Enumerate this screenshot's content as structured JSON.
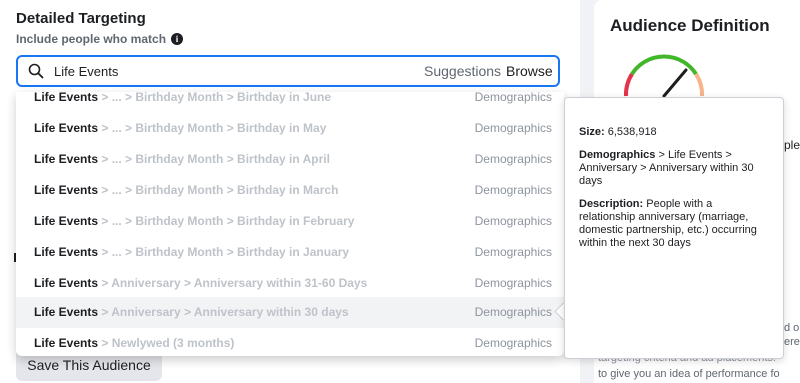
{
  "targeting": {
    "title": "Detailed Targeting",
    "subtitle": "Include people who match",
    "search_value": "Life Events",
    "suggestions_label": "Suggestions",
    "browse_label": "Browse"
  },
  "dropdown": {
    "rows": [
      {
        "root": "Life Events",
        "path": " > ... > Birthday Month > Birthday in June",
        "category": "Demographics"
      },
      {
        "root": "Life Events",
        "path": " > ... > Birthday Month > Birthday in May",
        "category": "Demographics"
      },
      {
        "root": "Life Events",
        "path": " > ... > Birthday Month > Birthday in April",
        "category": "Demographics"
      },
      {
        "root": "Life Events",
        "path": " > ... > Birthday Month > Birthday in March",
        "category": "Demographics"
      },
      {
        "root": "Life Events",
        "path": " > ... > Birthday Month > Birthday in February",
        "category": "Demographics"
      },
      {
        "root": "Life Events",
        "path": " > ... > Birthday Month > Birthday in January",
        "category": "Demographics"
      },
      {
        "root": "Life Events",
        "path": " > Anniversary > Anniversary within 31-60 Days",
        "category": "Demographics"
      },
      {
        "root": "Life Events",
        "path": " > Anniversary > Anniversary within 30 days",
        "category": "Demographics"
      },
      {
        "root": "Life Events",
        "path": " > Newlywed (3 months)",
        "category": "Demographics"
      }
    ]
  },
  "save_button_label": "Save This Audience",
  "audience": {
    "title": "Audience Definition",
    "frag_ple": "ple",
    "frag_lines": [
      "d or",
      "ere",
      "targeting criteria and ad placements.",
      "to give you an idea of performance fo"
    ]
  },
  "tooltip": {
    "size_label": "Size:",
    "size_value": " 6,538,918",
    "path_label": "Demographics",
    "path_rest": " > Life Events > Anniversary > Anniversary within 30 days",
    "desc_label": "Description:",
    "desc_value": " People with a relationship anniversary (marriage, domestic partnership, etc.) occurring within the next 30 days"
  },
  "colors": {
    "accent": "#1877f2",
    "gauge_red": "#e3344b",
    "gauge_green": "#42b72a",
    "gauge_peach": "#f7b38b"
  }
}
